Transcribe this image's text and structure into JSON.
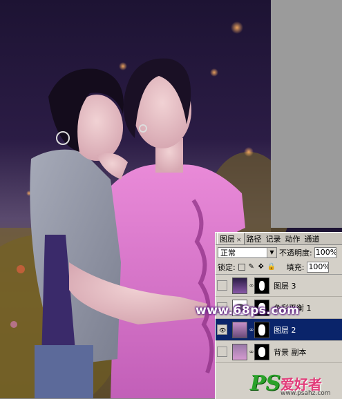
{
  "panel": {
    "tabs": [
      {
        "label": "图层",
        "active": true,
        "close": "×"
      },
      {
        "label": "路径",
        "active": false
      },
      {
        "label": "记录",
        "active": false
      },
      {
        "label": "动作",
        "active": false
      },
      {
        "label": "通道",
        "active": false
      }
    ],
    "blend_mode": "正常",
    "opacity_label": "不透明度:",
    "opacity_value": "100%",
    "lock_label": "锁定:",
    "fill_label": "填充:",
    "fill_value": "100%",
    "layers": [
      {
        "name": "图层 3",
        "visible": false,
        "selected": false,
        "type": "image"
      },
      {
        "name": "色彩平衡 1",
        "visible": false,
        "selected": false,
        "type": "adjustment"
      },
      {
        "name": "图层 2",
        "visible": true,
        "selected": true,
        "type": "image"
      },
      {
        "name": "背景 副本",
        "visible": false,
        "selected": false,
        "type": "image"
      }
    ]
  },
  "watermarks": {
    "site": "www.68ps.com",
    "brand_ps": "PS",
    "brand_cn": "爱好者",
    "brand_url": "www.psahz.com"
  },
  "colors": {
    "selected_layer": "#0a246a",
    "panel_bg": "#d4d0c8",
    "canvas_gray": "#9b9b9b"
  }
}
